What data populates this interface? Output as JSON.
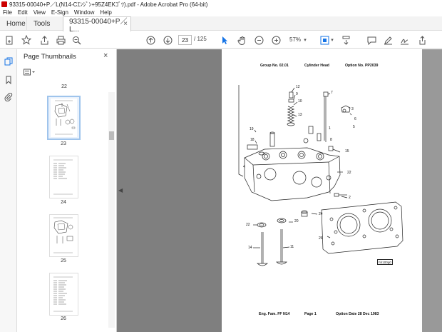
{
  "window": {
    "title": "93315-00040+P／L(N14-Cｴﾝｼﾞﾝ+95Z4EKｺﾞﾂ).pdf - Adobe Acrobat Pro (64-bit)"
  },
  "menu": [
    "File",
    "Edit",
    "View",
    "E-Sign",
    "Window",
    "Help"
  ],
  "tabs": {
    "home": "Home",
    "tools": "Tools",
    "document": "93315-00040+P／L...",
    "close": "×"
  },
  "toolbar": {
    "current_page": "23",
    "total_pages": "/ 125",
    "zoom": "57%"
  },
  "thumbnail_panel": {
    "title": "Page Thumbnails",
    "close": "×",
    "pages": [
      {
        "label": "22"
      },
      {
        "label": "23"
      },
      {
        "label": "24"
      },
      {
        "label": "25"
      },
      {
        "label": "26"
      }
    ]
  },
  "document_page": {
    "header": {
      "group": "Group No. 02.01",
      "title": "Cylinder Head",
      "option": "Option No. PP2039"
    },
    "footer": {
      "family": "Eng. Fam. FF N14",
      "page": "Page  1",
      "date": "Option Date  28 Dec 1983"
    },
    "drawing_code": "hh100g0",
    "callouts": [
      "12",
      "9",
      "10",
      "7",
      "3",
      "6",
      "5",
      "13",
      "1",
      "19",
      "18",
      "8",
      "15",
      "4",
      "22",
      "2",
      "24",
      "22",
      "20",
      "26",
      "14",
      "11"
    ]
  },
  "colors": {
    "accent": "#1473e6",
    "doc_background": "#7f7f7f",
    "selected_thumb": "#9fc4ec"
  }
}
